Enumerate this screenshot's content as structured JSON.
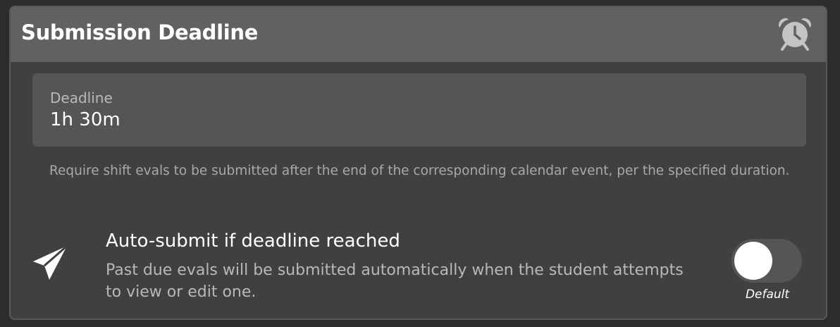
{
  "card": {
    "title": "Submission Deadline",
    "header_icon": "alarm-clock-icon"
  },
  "deadline_field": {
    "label": "Deadline",
    "value": "1h 30m"
  },
  "helper_text": "Require shift evals to be submitted after the end of the corresponding calendar event, per the specified duration.",
  "auto_submit": {
    "icon": "paper-plane-icon",
    "title": "Auto-submit if deadline reached",
    "description": "Past due evals will be submitted automatically when the student attempts to view or edit one.",
    "toggle_on": false,
    "toggle_caption": "Default"
  },
  "colors": {
    "page_background": "#2c2c2c",
    "card_background": "#404040",
    "header_background": "#616161",
    "field_background": "#555555",
    "icon_color": "#c4c4c4"
  }
}
